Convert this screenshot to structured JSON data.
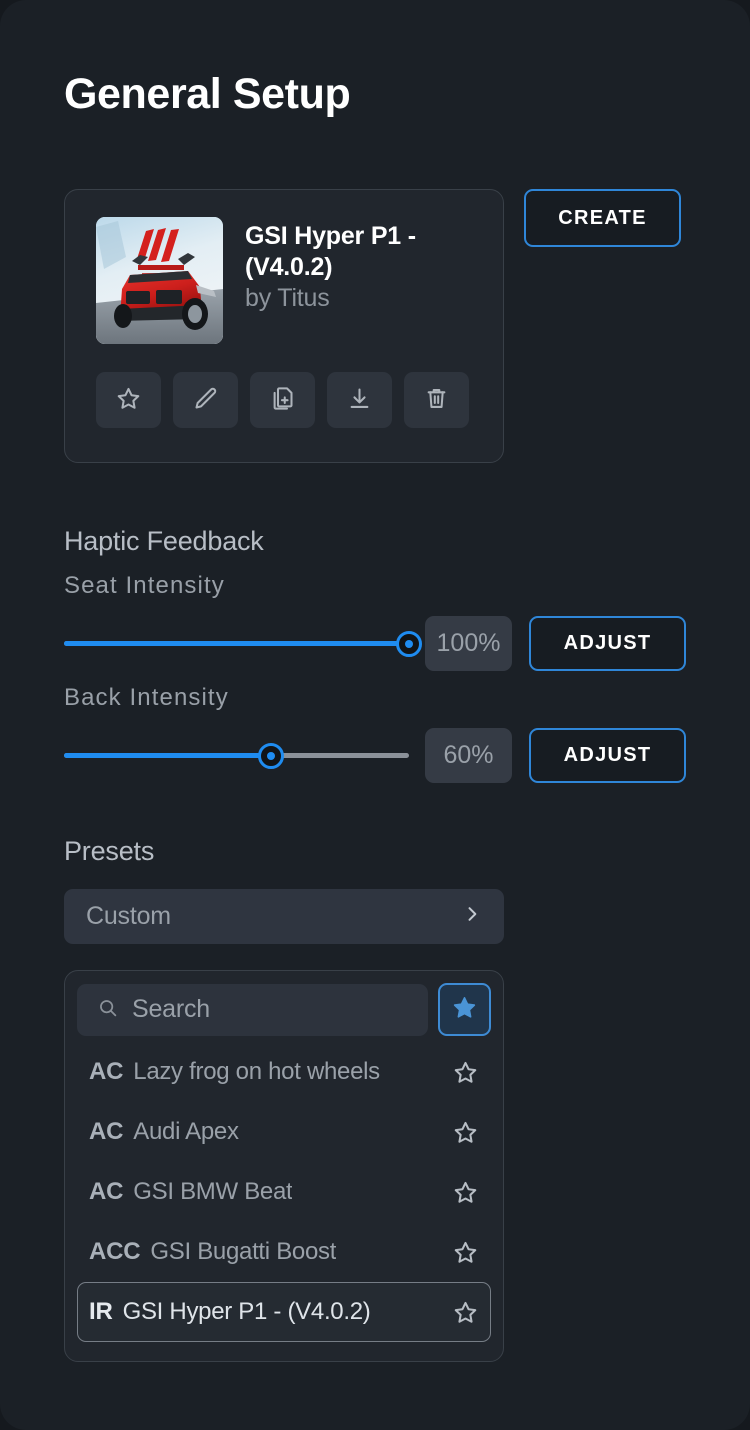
{
  "page": {
    "title": "General Setup"
  },
  "profile": {
    "name": "GSI Hyper P1 - (V4.0.2)",
    "author": "by Titus",
    "thumbnail_alt": "assetto-corsa-cover-art",
    "actions": [
      {
        "name": "favorite",
        "icon": "star-icon"
      },
      {
        "name": "edit",
        "icon": "pencil-icon"
      },
      {
        "name": "duplicate",
        "icon": "copy-document-icon"
      },
      {
        "name": "download",
        "icon": "download-icon"
      },
      {
        "name": "delete",
        "icon": "trash-icon"
      }
    ],
    "create_label": "CREATE"
  },
  "haptic": {
    "heading": "Haptic Feedback",
    "sliders": [
      {
        "label": "Seat  Intensity",
        "value": 100,
        "display": "100%",
        "adjust_label": "ADJUST"
      },
      {
        "label": "Back  Intensity",
        "value": 60,
        "display": "60%",
        "adjust_label": "ADJUST"
      }
    ]
  },
  "presets": {
    "heading": "Presets",
    "selected": "Custom",
    "search_placeholder": "Search",
    "search_value": "",
    "favorites_filter_active": true,
    "items": [
      {
        "tag": "AC",
        "label": "Lazy frog on hot wheels",
        "favorite": false,
        "selected": false
      },
      {
        "tag": "AC",
        "label": "Audi Apex",
        "favorite": false,
        "selected": false
      },
      {
        "tag": "AC",
        "label": "GSI BMW Beat",
        "favorite": false,
        "selected": false
      },
      {
        "tag": "ACC",
        "label": "GSI Bugatti Boost",
        "favorite": false,
        "selected": false
      },
      {
        "tag": "IR",
        "label": "GSI Hyper P1 - (V4.0.2)",
        "favorite": false,
        "selected": true
      }
    ]
  },
  "colors": {
    "page_bg": "#1b2026",
    "panel_bg": "#21262d",
    "accent_blue": "#1f8cf0",
    "border_blue": "#2f86d8",
    "text_primary": "#ffffff",
    "text_muted": "#9aa1a9"
  }
}
